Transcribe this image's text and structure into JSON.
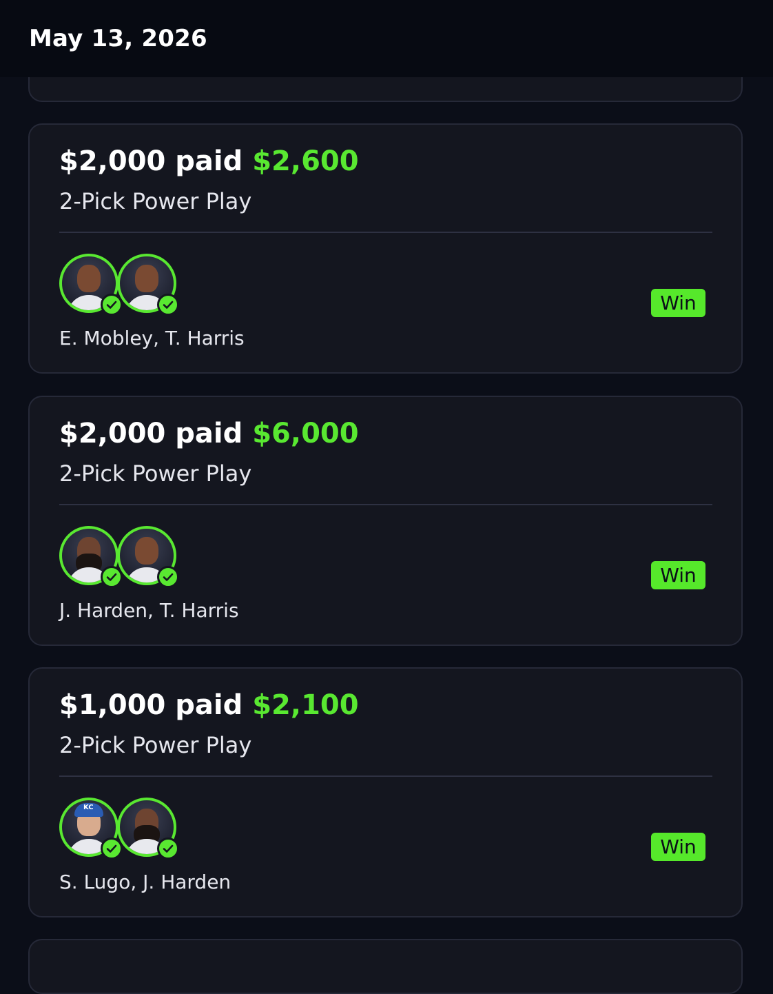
{
  "header": {
    "date": "May 13, 2026"
  },
  "entries": [
    {
      "paid_amount": "$2,000",
      "paid_word": "paid",
      "payout": "$2,600",
      "play_type": "2-Pick Power Play",
      "players": "E. Mobley, T. Harris",
      "status": "Win"
    },
    {
      "paid_amount": "$2,000",
      "paid_word": "paid",
      "payout": "$6,000",
      "play_type": "2-Pick Power Play",
      "players": "J. Harden, T. Harris",
      "status": "Win"
    },
    {
      "paid_amount": "$1,000",
      "paid_word": "paid",
      "payout": "$2,100",
      "play_type": "2-Pick Power Play",
      "players": "S. Lugo, J. Harden",
      "status": "Win"
    }
  ],
  "colors": {
    "background": "#0b0e18",
    "card": "#14161f",
    "accent_green": "#59e831",
    "win_badge": "#56e82b"
  },
  "icons": [
    "check-circle-icon",
    "player-avatar"
  ]
}
